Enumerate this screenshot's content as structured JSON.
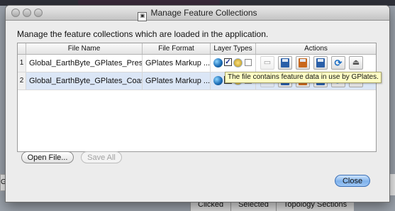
{
  "background": {
    "left_fragment": "Gl",
    "tabs": [
      "Clicked",
      "Selected",
      "Topology Sections"
    ]
  },
  "window": {
    "title": "Manage Feature Collections",
    "title_icon": "window-icon"
  },
  "description": "Manage the feature collections which are loaded in the application.",
  "table": {
    "headers": {
      "file_name": "File Name",
      "file_format": "File Format",
      "layer_types": "Layer Types",
      "actions": "Actions"
    },
    "rows": [
      {
        "index": "1",
        "file_name": "Global_EarthByte_GPlates_Pres...",
        "file_format": "GPlates Markup ...",
        "checked": "✓",
        "selected": false
      },
      {
        "index": "2",
        "file_name": "Global_EarthByte_GPlates_Coas...",
        "file_format": "GPlates Markup ...",
        "checked": "✓",
        "selected": true
      }
    ]
  },
  "tooltip": "The file contains feature data in use by GPlates.",
  "buttons": {
    "open_file": "Open File...",
    "save_all": "Save All",
    "close": "Close"
  },
  "icons": {
    "reload_glyph": "⟳",
    "eject_glyph": "⏏"
  }
}
